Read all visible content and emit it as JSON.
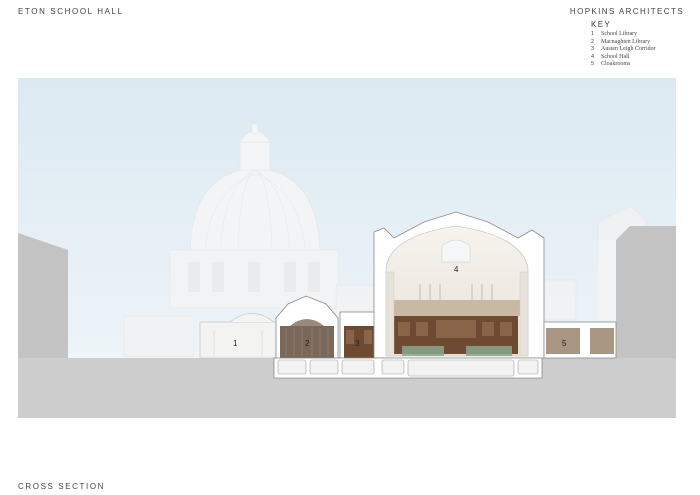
{
  "header": {
    "project_title": "ETON SCHOOL HALL",
    "architect": "HOPKINS ARCHITECTS"
  },
  "key": {
    "heading": "KEY",
    "items": [
      {
        "num": "1",
        "label": "School Library"
      },
      {
        "num": "2",
        "label": "Macnaghten Library"
      },
      {
        "num": "3",
        "label": "Austen Leigh Corridor"
      },
      {
        "num": "4",
        "label": "School Hall"
      },
      {
        "num": "5",
        "label": "Cloakrooms"
      }
    ]
  },
  "section_labels": [
    "1",
    "2",
    "3",
    "4",
    "5"
  ],
  "caption": "CROSS SECTION",
  "colors": {
    "sky_top": "#dbe9f2",
    "sky_bottom": "#eaf2f7",
    "ground": "#cdcdcd",
    "neighbour_buildings": "#c3c3c3",
    "section_cut": "#ffffff",
    "timber": "#6e4a32",
    "hedge": "#8aa78a"
  }
}
